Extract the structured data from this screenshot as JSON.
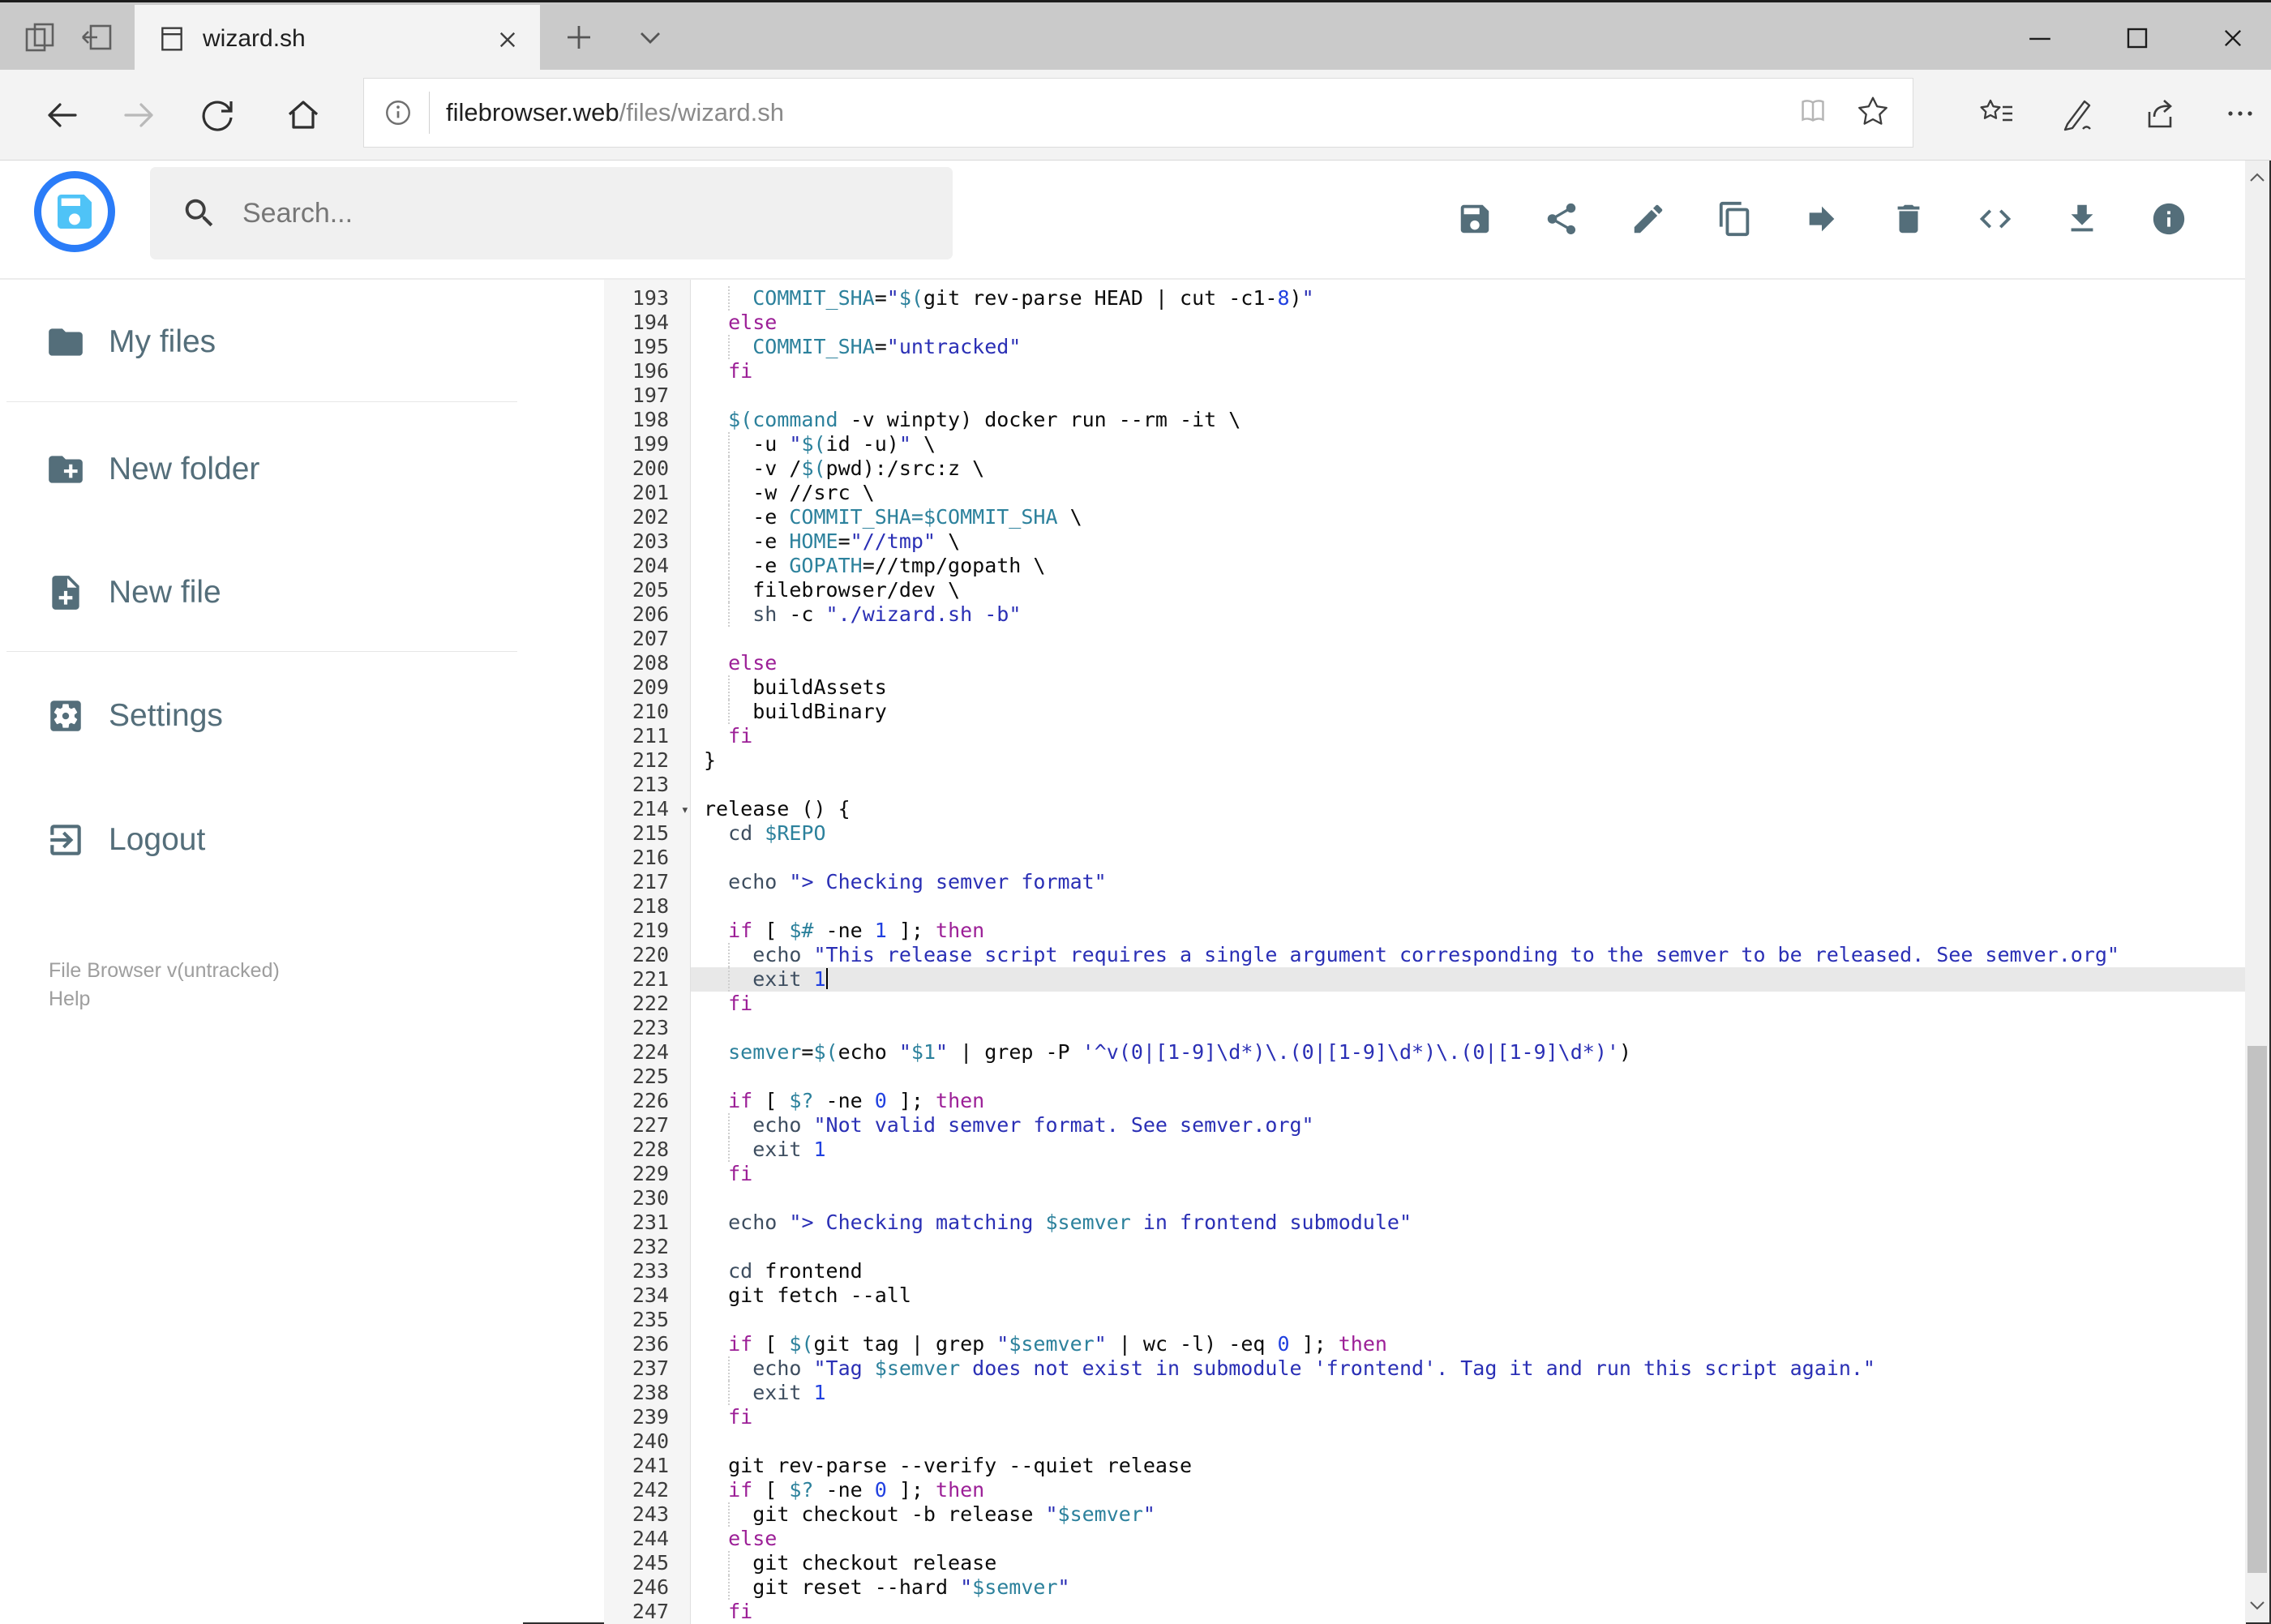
{
  "window": {
    "tab_title": "wizard.sh"
  },
  "browser": {
    "url_host": "filebrowser.web",
    "url_path": "/files/wizard.sh"
  },
  "header": {
    "search_placeholder": "Search...",
    "actions": [
      "save",
      "share",
      "edit",
      "copy",
      "move",
      "delete",
      "code",
      "download",
      "info"
    ]
  },
  "sidebar": {
    "items": [
      {
        "name": "my-files",
        "label": "My files"
      },
      {
        "name": "new-folder",
        "label": "New folder"
      },
      {
        "name": "new-file",
        "label": "New file"
      },
      {
        "name": "settings",
        "label": "Settings"
      },
      {
        "name": "logout",
        "label": "Logout"
      }
    ],
    "version": "File Browser v(untracked)",
    "help": "Help"
  },
  "editor": {
    "language": "shell",
    "fold_marker": "▾",
    "active_line": 221,
    "colors": {
      "plain": "#0b0b0b",
      "keyword": "#9c1f97",
      "builtin": "#3e4e60",
      "variable": "#2c819c",
      "string": "#2a2fb5",
      "number": "#2040e0",
      "line_number": "#3d3d3d"
    },
    "lines": [
      {
        "n": 193,
        "i": 4,
        "t": [
          [
            "v",
            "COMMIT_SHA"
          ],
          [
            "p",
            "="
          ],
          [
            "s",
            "\""
          ],
          [
            "v",
            "$("
          ],
          [
            "p",
            "git rev-parse HEAD | cut -c1-"
          ],
          [
            "n",
            "8"
          ],
          [
            "p",
            ")"
          ],
          [
            "s",
            "\""
          ]
        ]
      },
      {
        "n": 194,
        "i": 2,
        "t": [
          [
            "k",
            "else"
          ]
        ]
      },
      {
        "n": 195,
        "i": 4,
        "t": [
          [
            "v",
            "COMMIT_SHA"
          ],
          [
            "p",
            "="
          ],
          [
            "s",
            "\"untracked\""
          ]
        ]
      },
      {
        "n": 196,
        "i": 2,
        "t": [
          [
            "k",
            "fi"
          ]
        ]
      },
      {
        "n": 197,
        "i": 0,
        "t": []
      },
      {
        "n": 198,
        "i": 2,
        "t": [
          [
            "v",
            "$(command"
          ],
          [
            "p",
            " -v winpty) docker run --rm -it \\"
          ]
        ]
      },
      {
        "n": 199,
        "i": 4,
        "t": [
          [
            "p",
            "-u "
          ],
          [
            "s",
            "\""
          ],
          [
            "v",
            "$("
          ],
          [
            "p",
            "id -u)"
          ],
          [
            "s",
            "\""
          ],
          [
            "p",
            " \\"
          ]
        ]
      },
      {
        "n": 200,
        "i": 4,
        "t": [
          [
            "p",
            "-v /"
          ],
          [
            "v",
            "$("
          ],
          [
            "p",
            "pwd):/src:z \\"
          ]
        ]
      },
      {
        "n": 201,
        "i": 4,
        "t": [
          [
            "p",
            "-w //src \\"
          ]
        ]
      },
      {
        "n": 202,
        "i": 4,
        "t": [
          [
            "p",
            "-e "
          ],
          [
            "v",
            "COMMIT_SHA=$COMMIT_SHA"
          ],
          [
            "p",
            " \\"
          ]
        ]
      },
      {
        "n": 203,
        "i": 4,
        "t": [
          [
            "p",
            "-e "
          ],
          [
            "v",
            "HOME"
          ],
          [
            "p",
            "="
          ],
          [
            "s",
            "\"//tmp\""
          ],
          [
            "p",
            " \\"
          ]
        ]
      },
      {
        "n": 204,
        "i": 4,
        "t": [
          [
            "p",
            "-e "
          ],
          [
            "v",
            "GOPATH"
          ],
          [
            "p",
            "=//tmp/gopath \\"
          ]
        ]
      },
      {
        "n": 205,
        "i": 4,
        "t": [
          [
            "p",
            "filebrowser/dev \\"
          ]
        ]
      },
      {
        "n": 206,
        "i": 4,
        "t": [
          [
            "b",
            "sh"
          ],
          [
            "p",
            " -c "
          ],
          [
            "s",
            "\"./wizard.sh -b\""
          ]
        ]
      },
      {
        "n": 207,
        "i": 0,
        "t": []
      },
      {
        "n": 208,
        "i": 2,
        "t": [
          [
            "k",
            "else"
          ]
        ]
      },
      {
        "n": 209,
        "i": 4,
        "t": [
          [
            "p",
            "buildAssets"
          ]
        ]
      },
      {
        "n": 210,
        "i": 4,
        "t": [
          [
            "p",
            "buildBinary"
          ]
        ]
      },
      {
        "n": 211,
        "i": 2,
        "t": [
          [
            "k",
            "fi"
          ]
        ]
      },
      {
        "n": 212,
        "i": 0,
        "t": [
          [
            "p",
            "}"
          ]
        ]
      },
      {
        "n": 213,
        "i": 0,
        "t": []
      },
      {
        "n": 214,
        "i": 0,
        "fold": true,
        "t": [
          [
            "p",
            "release () {"
          ]
        ]
      },
      {
        "n": 215,
        "i": 2,
        "t": [
          [
            "b",
            "cd"
          ],
          [
            "p",
            " "
          ],
          [
            "v",
            "$REPO"
          ]
        ]
      },
      {
        "n": 216,
        "i": 0,
        "t": []
      },
      {
        "n": 217,
        "i": 2,
        "t": [
          [
            "b",
            "echo"
          ],
          [
            "p",
            " "
          ],
          [
            "s",
            "\"> Checking semver format\""
          ]
        ]
      },
      {
        "n": 218,
        "i": 0,
        "t": []
      },
      {
        "n": 219,
        "i": 2,
        "t": [
          [
            "k",
            "if"
          ],
          [
            "p",
            " [ "
          ],
          [
            "v",
            "$#"
          ],
          [
            "p",
            " -ne "
          ],
          [
            "n",
            "1"
          ],
          [
            "p",
            " ]; "
          ],
          [
            "k",
            "then"
          ]
        ]
      },
      {
        "n": 220,
        "i": 4,
        "t": [
          [
            "b",
            "echo"
          ],
          [
            "p",
            " "
          ],
          [
            "s",
            "\"This release script requires a single argument corresponding to the semver to be released. See semver.org\""
          ]
        ]
      },
      {
        "n": 221,
        "i": 4,
        "active": true,
        "cursor": true,
        "t": [
          [
            "b",
            "exit"
          ],
          [
            "p",
            " "
          ],
          [
            "n",
            "1"
          ]
        ]
      },
      {
        "n": 222,
        "i": 2,
        "t": [
          [
            "k",
            "fi"
          ]
        ]
      },
      {
        "n": 223,
        "i": 0,
        "t": []
      },
      {
        "n": 224,
        "i": 2,
        "t": [
          [
            "v",
            "semver"
          ],
          [
            "p",
            "="
          ],
          [
            "v",
            "$("
          ],
          [
            "p",
            "echo "
          ],
          [
            "s",
            "\""
          ],
          [
            "v",
            "$1"
          ],
          [
            "s",
            "\""
          ],
          [
            "p",
            " | grep -P "
          ],
          [
            "s",
            "'^v(0|[1-9]\\d*)\\.(0|[1-9]\\d*)\\.(0|[1-9]\\d*)'"
          ],
          [
            "p",
            ")"
          ]
        ]
      },
      {
        "n": 225,
        "i": 0,
        "t": []
      },
      {
        "n": 226,
        "i": 2,
        "t": [
          [
            "k",
            "if"
          ],
          [
            "p",
            " [ "
          ],
          [
            "v",
            "$?"
          ],
          [
            "p",
            " -ne "
          ],
          [
            "n",
            "0"
          ],
          [
            "p",
            " ]; "
          ],
          [
            "k",
            "then"
          ]
        ]
      },
      {
        "n": 227,
        "i": 4,
        "t": [
          [
            "b",
            "echo"
          ],
          [
            "p",
            " "
          ],
          [
            "s",
            "\"Not valid semver format. See semver.org\""
          ]
        ]
      },
      {
        "n": 228,
        "i": 4,
        "t": [
          [
            "b",
            "exit"
          ],
          [
            "p",
            " "
          ],
          [
            "n",
            "1"
          ]
        ]
      },
      {
        "n": 229,
        "i": 2,
        "t": [
          [
            "k",
            "fi"
          ]
        ]
      },
      {
        "n": 230,
        "i": 0,
        "t": []
      },
      {
        "n": 231,
        "i": 2,
        "t": [
          [
            "b",
            "echo"
          ],
          [
            "p",
            " "
          ],
          [
            "s",
            "\"> Checking matching "
          ],
          [
            "v",
            "$semver"
          ],
          [
            "s",
            " in frontend submodule\""
          ]
        ]
      },
      {
        "n": 232,
        "i": 0,
        "t": []
      },
      {
        "n": 233,
        "i": 2,
        "t": [
          [
            "b",
            "cd"
          ],
          [
            "p",
            " frontend"
          ]
        ]
      },
      {
        "n": 234,
        "i": 2,
        "t": [
          [
            "p",
            "git fetch --all"
          ]
        ]
      },
      {
        "n": 235,
        "i": 0,
        "t": []
      },
      {
        "n": 236,
        "i": 2,
        "t": [
          [
            "k",
            "if"
          ],
          [
            "p",
            " [ "
          ],
          [
            "v",
            "$("
          ],
          [
            "p",
            "git tag | grep "
          ],
          [
            "s",
            "\""
          ],
          [
            "v",
            "$semver"
          ],
          [
            "s",
            "\""
          ],
          [
            "p",
            " | wc -l) -eq "
          ],
          [
            "n",
            "0"
          ],
          [
            "p",
            " ]; "
          ],
          [
            "k",
            "then"
          ]
        ]
      },
      {
        "n": 237,
        "i": 4,
        "t": [
          [
            "b",
            "echo"
          ],
          [
            "p",
            " "
          ],
          [
            "s",
            "\"Tag "
          ],
          [
            "v",
            "$semver"
          ],
          [
            "s",
            " does not exist in submodule 'frontend'. Tag it and run this script again.\""
          ]
        ]
      },
      {
        "n": 238,
        "i": 4,
        "t": [
          [
            "b",
            "exit"
          ],
          [
            "p",
            " "
          ],
          [
            "n",
            "1"
          ]
        ]
      },
      {
        "n": 239,
        "i": 2,
        "t": [
          [
            "k",
            "fi"
          ]
        ]
      },
      {
        "n": 240,
        "i": 0,
        "t": []
      },
      {
        "n": 241,
        "i": 2,
        "t": [
          [
            "p",
            "git rev-parse --verify --quiet release"
          ]
        ]
      },
      {
        "n": 242,
        "i": 2,
        "t": [
          [
            "k",
            "if"
          ],
          [
            "p",
            " [ "
          ],
          [
            "v",
            "$?"
          ],
          [
            "p",
            " -ne "
          ],
          [
            "n",
            "0"
          ],
          [
            "p",
            " ]; "
          ],
          [
            "k",
            "then"
          ]
        ]
      },
      {
        "n": 243,
        "i": 4,
        "t": [
          [
            "p",
            "git checkout -b release "
          ],
          [
            "s",
            "\""
          ],
          [
            "v",
            "$semver"
          ],
          [
            "s",
            "\""
          ]
        ]
      },
      {
        "n": 244,
        "i": 2,
        "t": [
          [
            "k",
            "else"
          ]
        ]
      },
      {
        "n": 245,
        "i": 4,
        "t": [
          [
            "p",
            "git checkout release"
          ]
        ]
      },
      {
        "n": 246,
        "i": 4,
        "t": [
          [
            "p",
            "git reset --hard "
          ],
          [
            "s",
            "\""
          ],
          [
            "v",
            "$semver"
          ],
          [
            "s",
            "\""
          ]
        ]
      },
      {
        "n": 247,
        "i": 2,
        "t": [
          [
            "k",
            "fi"
          ]
        ]
      }
    ]
  }
}
